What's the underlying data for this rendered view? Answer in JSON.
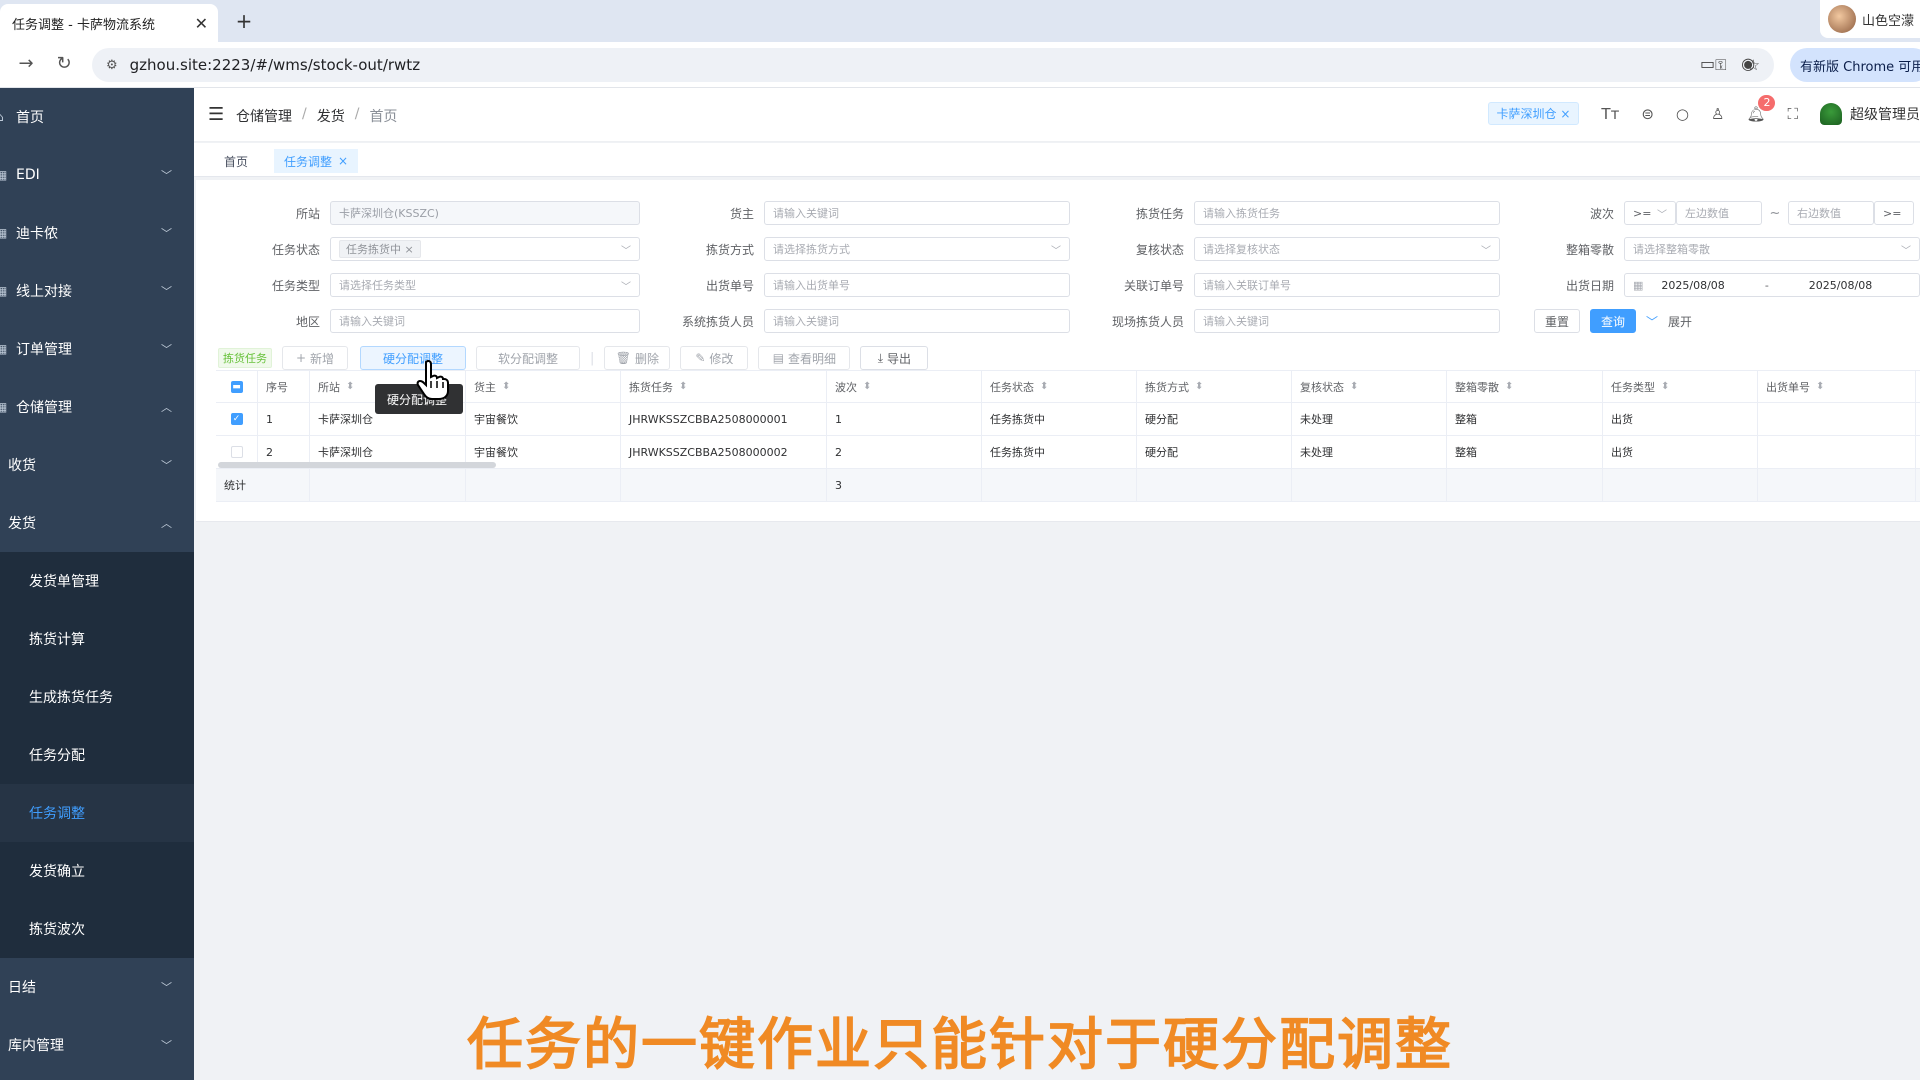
{
  "browser": {
    "tab_title": "任务调整 - 卡萨物流系统",
    "tab_close": "✕",
    "new_tab": "+",
    "profile_name": "山色空濛",
    "url": "gzhou.site:2223/#/wms/stock-out/rwtz",
    "update_label": "有新版 Chrome 可用"
  },
  "sidebar": {
    "items": [
      {
        "label": "首页"
      },
      {
        "label": "EDI"
      },
      {
        "label": "迪卡侬"
      },
      {
        "label": "线上对接"
      },
      {
        "label": "订单管理"
      },
      {
        "label": "仓储管理"
      },
      {
        "label": "收货"
      },
      {
        "label": "发货"
      },
      {
        "label": "发货单管理"
      },
      {
        "label": "拣货计算"
      },
      {
        "label": "生成拣货任务"
      },
      {
        "label": "任务分配"
      },
      {
        "label": "任务调整"
      },
      {
        "label": "发货确立"
      },
      {
        "label": "拣货波次"
      },
      {
        "label": "日结"
      },
      {
        "label": "库内管理"
      }
    ]
  },
  "header": {
    "breadcrumb": [
      "仓储管理",
      "发货",
      "首页"
    ],
    "warehouse_tag": "卡萨深圳仓",
    "notification_count": "2",
    "user_name": "超级管理员"
  },
  "tags": {
    "home": "首页",
    "current": "任务调整"
  },
  "form": {
    "site_label": "所站",
    "site_value": "卡萨深圳仓(KSSZC)",
    "owner_label": "货主",
    "owner_ph": "请输入关键词",
    "pick_task_label": "拣货任务",
    "pick_task_ph": "请输入拣货任务",
    "wave_label": "波次",
    "wave_op": ">=",
    "wave_left_ph": "左边数值",
    "wave_tilde": "~",
    "wave_right_ph": "右边数值",
    "wave_op2": ">=",
    "task_status_label": "任务状态",
    "task_status_chip": "任务拣货中",
    "pick_method_label": "拣货方式",
    "pick_method_ph": "请选择拣货方式",
    "review_status_label": "复核状态",
    "review_status_ph": "请选择复核状态",
    "box_label": "整箱零散",
    "box_ph": "请选择整箱零散",
    "task_type_label": "任务类型",
    "task_type_ph": "请选择任务类型",
    "ship_no_label": "出货单号",
    "ship_no_ph": "请输入出货单号",
    "order_no_label": "关联订单号",
    "order_no_ph": "请输入关联订单号",
    "ship_date_label": "出货日期",
    "date_from": "2025/08/08",
    "date_sep": "-",
    "date_to": "2025/08/08",
    "region_label": "地区",
    "region_ph": "请输入关键词",
    "sys_picker_label": "系统拣货人员",
    "sys_picker_ph": "请输入关键词",
    "site_picker_label": "现场拣货人员",
    "site_picker_ph": "请输入关键词",
    "reset": "重置",
    "query": "查询",
    "expand": "展开"
  },
  "toolbar": {
    "tag": "拣货任务",
    "add": "新增",
    "hard_adjust": "硬分配调整",
    "soft_adjust": "软分配调整",
    "delete": "删除",
    "edit": "修改",
    "detail": "查看明细",
    "export": "导出"
  },
  "table": {
    "headers": [
      "序号",
      "所站",
      "货主",
      "拣货任务",
      "波次",
      "任务状态",
      "拣货方式",
      "复核状态",
      "整箱零散",
      "任务类型",
      "出货单号"
    ],
    "rows": [
      {
        "no": "1",
        "site": "卡萨深圳仓",
        "owner": "宇宙餐饮",
        "task": "JHRWKSSZCBBA2508000001",
        "wave": "1",
        "status": "任务拣货中",
        "method": "硬分配",
        "review": "未处理",
        "box": "整箱",
        "type": "出货",
        "ship": "",
        "checked": true
      },
      {
        "no": "2",
        "site": "卡萨深圳仓",
        "owner": "宇宙餐饮",
        "task": "JHRWKSSZCBBA2508000002",
        "wave": "2",
        "status": "任务拣货中",
        "method": "硬分配",
        "review": "未处理",
        "box": "整箱",
        "type": "出货",
        "ship": "",
        "checked": false
      }
    ],
    "summary_label": "统计",
    "summary_wave": "3"
  },
  "tooltip": "硬分配调整",
  "caption": "任务的一键作业只能针对于硬分配调整",
  "colors": {
    "accent": "#409eff",
    "sidebar": "#304156",
    "caption": "#f08a24"
  }
}
